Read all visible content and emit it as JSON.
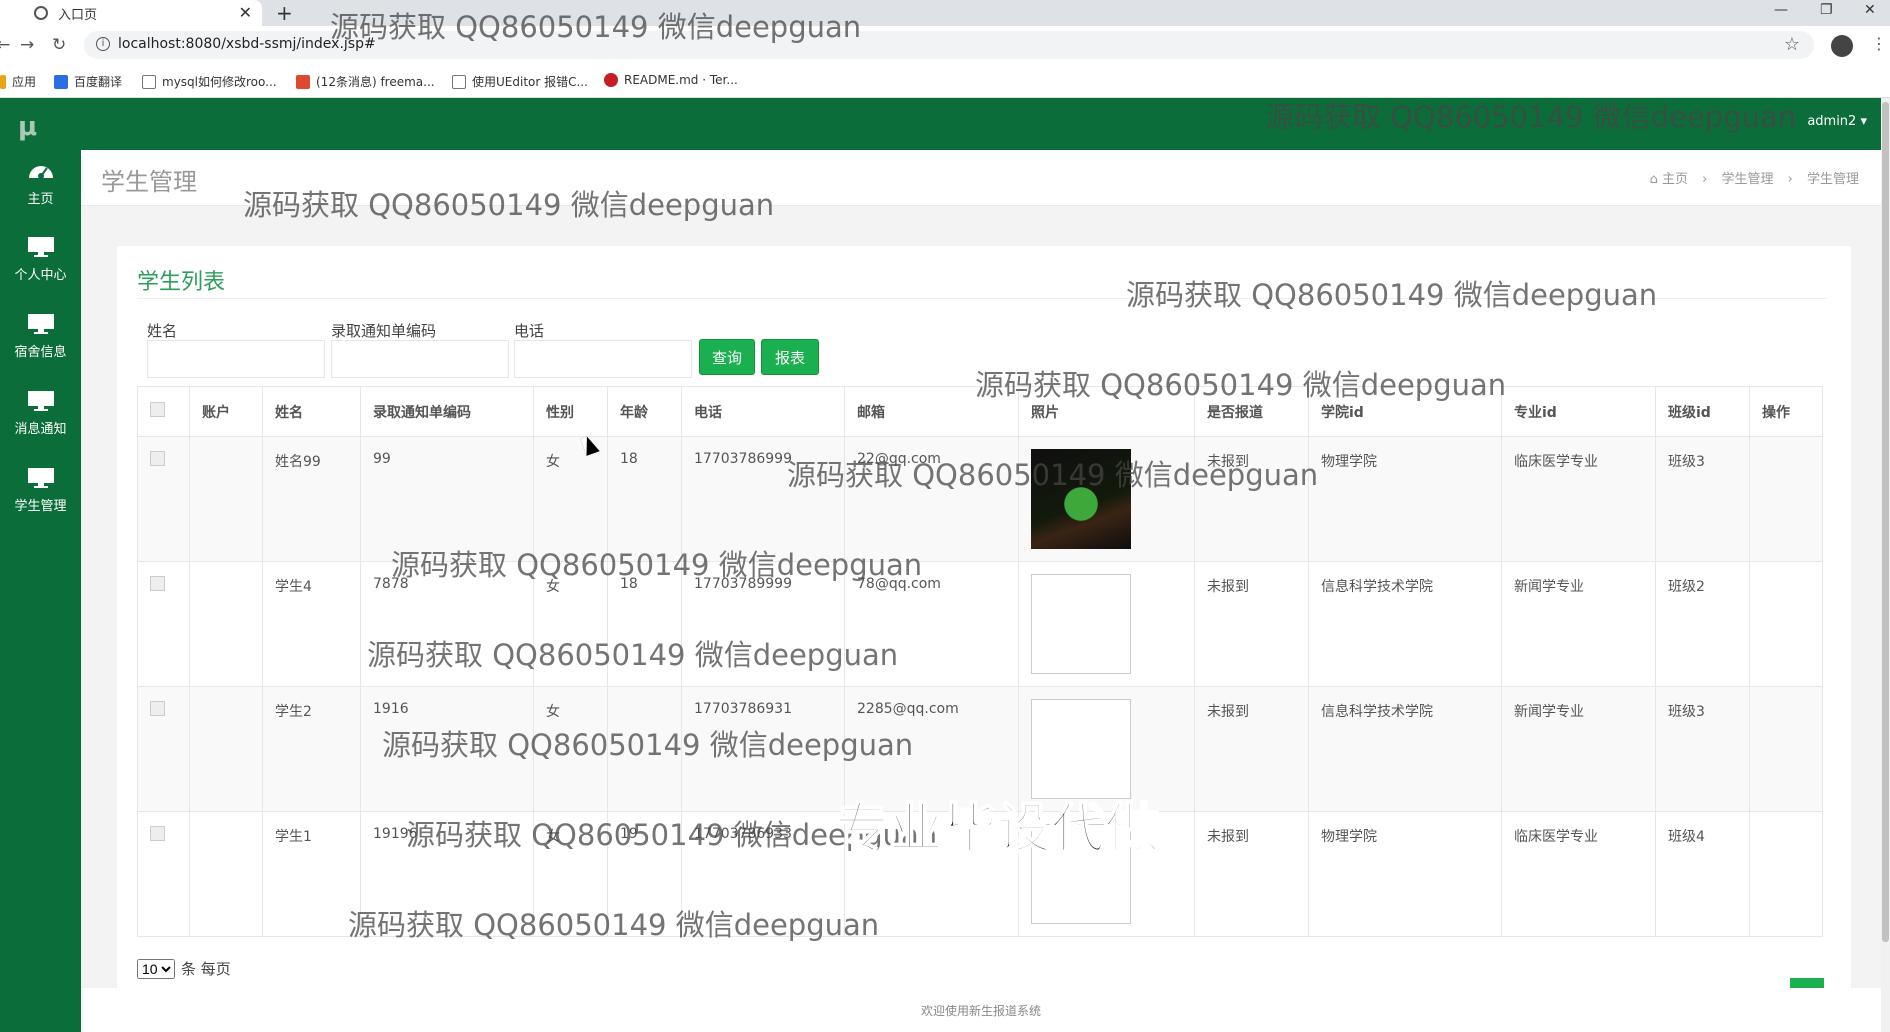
{
  "browser": {
    "tab_title": "入口页",
    "url": "localhost:8080/xsbd-ssmj/index.jsp#",
    "bookmarks": [
      "应用",
      "百度翻译",
      "mysql如何修改roo...",
      "(12条消息) freema...",
      "使用UEditor 报错C...",
      "README.md · Ter..."
    ]
  },
  "app": {
    "logo": "μ",
    "user": "admin2",
    "sidebar": [
      {
        "label": "主页",
        "icon": "dashboard-icon"
      },
      {
        "label": "个人中心",
        "icon": "monitor-icon"
      },
      {
        "label": "宿舍信息",
        "icon": "monitor-icon"
      },
      {
        "label": "消息通知",
        "icon": "monitor-icon"
      },
      {
        "label": "学生管理",
        "icon": "monitor-icon"
      }
    ],
    "page_title": "学生管理",
    "breadcrumb": [
      "主页",
      "学生管理",
      "学生管理"
    ],
    "panel_title": "学生列表",
    "filters": {
      "name_label": "姓名",
      "notice_code_label": "录取通知单编码",
      "phone_label": "电话"
    },
    "buttons": {
      "search": "查询",
      "report": "报表"
    },
    "columns": [
      "账户",
      "姓名",
      "录取通知单编码",
      "性别",
      "年龄",
      "电话",
      "邮箱",
      "照片",
      "是否报道",
      "学院id",
      "专业id",
      "班级id",
      "操作"
    ],
    "rows": [
      {
        "account": "",
        "name": "姓名99",
        "code": "99",
        "gender": "女",
        "age": "18",
        "phone": "17703786999",
        "email": "22@qq.com",
        "photo": "frog",
        "reported": "未报到",
        "college": "物理学院",
        "major": "临床医学专业",
        "class": "班级3"
      },
      {
        "account": "",
        "name": "学生4",
        "code": "7878",
        "gender": "女",
        "age": "18",
        "phone": "17703789999",
        "email": "78@qq.com",
        "photo": "broken",
        "reported": "未报到",
        "college": "信息科学技术学院",
        "major": "新闻学专业",
        "class": "班级2"
      },
      {
        "account": "",
        "name": "学生2",
        "code": "1916",
        "gender": "女",
        "age": "",
        "phone": "17703786931",
        "email": "2285@qq.com",
        "photo": "broken",
        "reported": "未报到",
        "college": "信息科学技术学院",
        "major": "新闻学专业",
        "class": "班级3"
      },
      {
        "account": "",
        "name": "学生1",
        "code": "19196",
        "gender": "女",
        "age": "19",
        "phone": "17703786933",
        "email": "",
        "photo": "broken",
        "reported": "未报到",
        "college": "物理学院",
        "major": "临床医学专业",
        "class": "班级4"
      }
    ],
    "pager": {
      "page_size": "10",
      "suffix": "条 每页"
    },
    "footer": "欢迎使用新生报道系统"
  },
  "watermarks": {
    "text": "源码获取 QQ86050149 微信deepguan",
    "big": "专业毕设代做"
  },
  "colors": {
    "sidebar": "#0b6d3a",
    "accent": "#1ab04f",
    "title": "#2e9e5b"
  }
}
